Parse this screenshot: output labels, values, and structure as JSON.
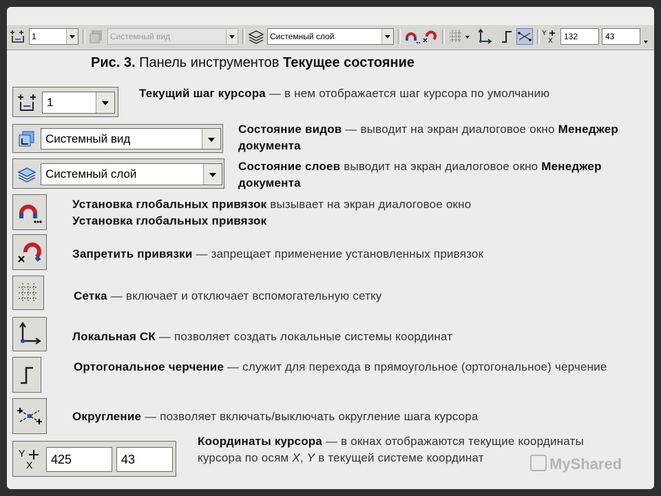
{
  "toolbar": {
    "step_value": "1",
    "view_value": "Системный вид",
    "layer_value": "Системный слой",
    "coord_x": "132",
    "coord_y": "43"
  },
  "caption": {
    "prefix": "Рис. 3.",
    "middle": "Панель инструментов",
    "bold": "Текущее состояние"
  },
  "items": [
    {
      "term": "Текущий шаг курсора",
      "text": " — в нем отображается шаг курсора по умолчанию",
      "control_value": "1"
    },
    {
      "term": "Состояние видов",
      "text": " — выводит на экран диалоговое окно ",
      "term2": "Менеджер документа",
      "control_value": "Системный вид"
    },
    {
      "term": "Состояние слоев",
      "text": " выводит на экран диалоговое окно ",
      "term2": "Менеджер документа",
      "control_value": "Системный слой"
    },
    {
      "term": "Установка глобальных привязок",
      "text": " вызывает на экран диалоговое окно ",
      "term2": "Установка глобальных привязок"
    },
    {
      "term": "Запретить привязки",
      "text": " — запрещает применение установленных привязок"
    },
    {
      "term": "Сетка",
      "text": " — включает и отключает вспомогательную сетку"
    },
    {
      "term": "Локальная СК",
      "text": " — позволяет создать локальные системы координат"
    },
    {
      "term": "Ортогональное черчение",
      "text": " — служит для перехода в прямоугольное (ортогональное) черчение"
    },
    {
      "term": "Округление",
      "text": " — позволяет включать/выключать округление шага курсора"
    },
    {
      "term": "Координаты курсора",
      "text": " — в окнах отображаются текущие координаты курсора по осям ",
      "italic1": "X",
      "mid": ", ",
      "italic2": "Y",
      "tail": " в текущей системе координат",
      "x_value": "425",
      "y_value": "43"
    }
  ],
  "watermark": "MyShared"
}
